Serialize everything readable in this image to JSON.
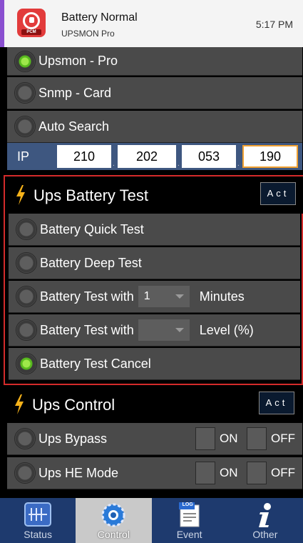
{
  "notification": {
    "title": "Battery Normal",
    "app": "UPSMON Pro",
    "time": "5:17 PM",
    "icon_tag": "PCM"
  },
  "connection": {
    "options": [
      {
        "label": "Upsmon - Pro",
        "selected": true
      },
      {
        "label": "Snmp - Card",
        "selected": false
      },
      {
        "label": "Auto Search",
        "selected": false
      }
    ],
    "ip_label": "IP",
    "ip": [
      "210",
      "202",
      "053",
      "190"
    ],
    "ip_sep": "."
  },
  "battery_test": {
    "title": "Ups Battery Test",
    "act_label": "Act",
    "quick": "Battery Quick Test",
    "deep": "Battery Deep Test",
    "minutes_prefix": "Battery Test with",
    "minutes_value": "1",
    "minutes_unit": "Minutes",
    "level_prefix": "Battery Test with",
    "level_value": "",
    "level_unit": "Level (%)",
    "cancel": "Battery Test Cancel"
  },
  "ups_control": {
    "title": "Ups Control",
    "act_label": "Act",
    "bypass": "Ups Bypass",
    "he_mode": "Ups HE Mode",
    "on": "ON",
    "off": "OFF"
  },
  "tabs": [
    {
      "label": "Status"
    },
    {
      "label": "Control"
    },
    {
      "label": "Event",
      "icon_text": "LOG"
    },
    {
      "label": "Other"
    }
  ],
  "colors": {
    "accent_bolt": "#f6b21a",
    "radio_on": "#6fcf2a",
    "panel_border": "#d42b2b",
    "tabbar": "#1e3a6e",
    "notification_strip": "#8a4fd0",
    "app_icon": "#e23b3b"
  }
}
